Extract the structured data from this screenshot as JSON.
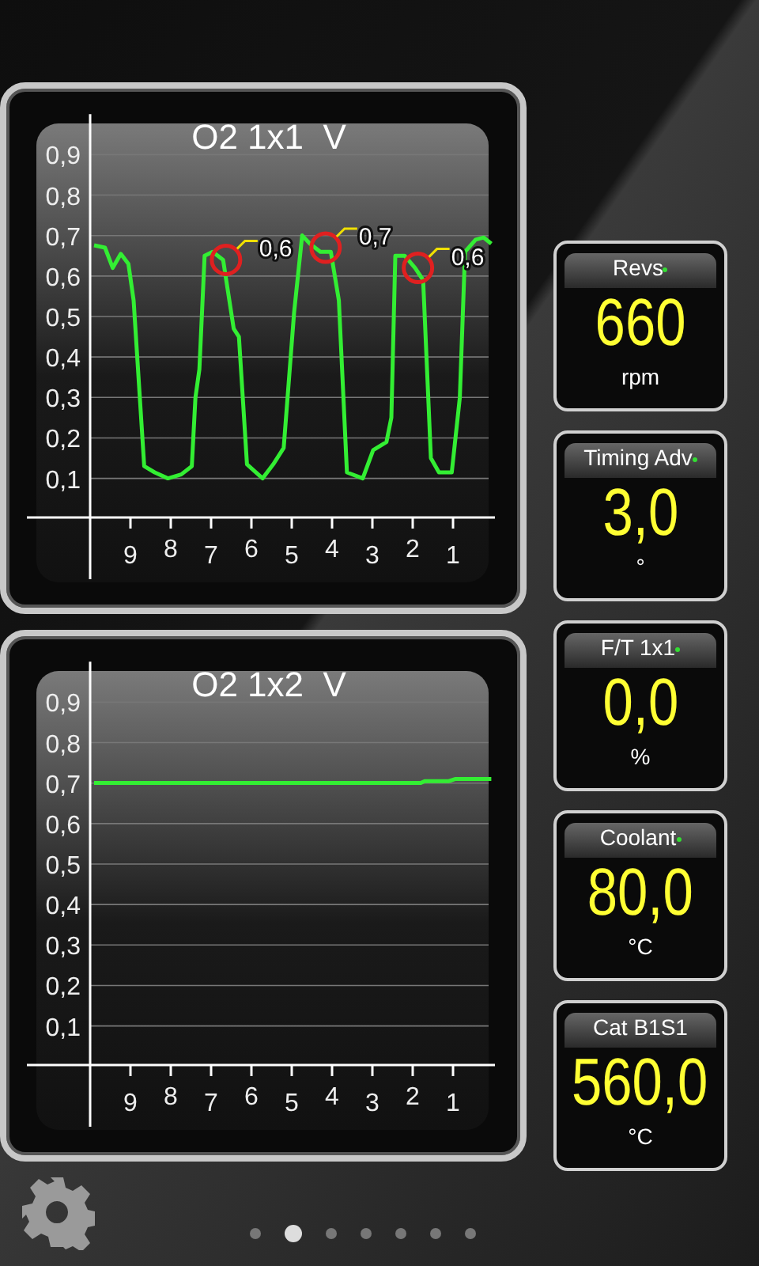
{
  "charts": [
    {
      "chart_data": {
        "type": "line",
        "title": "O2 1x1  V",
        "x": [
          9.9,
          9.63,
          9.44,
          9.24,
          9.05,
          8.92,
          8.66,
          8.4,
          8.07,
          7.74,
          7.48,
          7.39,
          7.29,
          7.16,
          6.96,
          6.7,
          6.44,
          6.31,
          6.11,
          5.72,
          5.46,
          5.2,
          4.94,
          4.74,
          4.55,
          4.29,
          4.03,
          3.83,
          3.63,
          3.24,
          2.98,
          2.65,
          2.53,
          2.43,
          2.2,
          1.94,
          1.74,
          1.55,
          1.35,
          1.03,
          0.83,
          0.7,
          0.44,
          0.24,
          0.05
        ],
        "series": [
          {
            "color": "#33ee33",
            "values": [
              0.676,
              0.67,
              0.62,
              0.655,
              0.63,
              0.54,
              0.13,
              0.115,
              0.1,
              0.11,
              0.13,
              0.3,
              0.37,
              0.65,
              0.66,
              0.64,
              0.47,
              0.45,
              0.135,
              0.1,
              0.135,
              0.175,
              0.51,
              0.7,
              0.68,
              0.66,
              0.66,
              0.54,
              0.115,
              0.1,
              0.17,
              0.19,
              0.25,
              0.65,
              0.65,
              0.62,
              0.59,
              0.15,
              0.115,
              0.115,
              0.3,
              0.66,
              0.69,
              0.695,
              0.68
            ]
          }
        ],
        "xlim": [
          10,
          0
        ],
        "ylim": [
          0,
          1
        ],
        "xticks": [
          9,
          8,
          7,
          6,
          5,
          4,
          3,
          2,
          1
        ],
        "yticks": [
          {
            "value": 0.9,
            "label": "0,9"
          },
          {
            "value": 0.8,
            "label": "0,8"
          },
          {
            "value": 0.7,
            "label": "0,7"
          },
          {
            "value": 0.6,
            "label": "0,6"
          },
          {
            "value": 0.5,
            "label": "0,5"
          },
          {
            "value": 0.4,
            "label": "0,4"
          },
          {
            "value": 0.3,
            "label": "0,3"
          },
          {
            "value": 0.2,
            "label": "0,2"
          },
          {
            "value": 0.1,
            "label": "0,1"
          }
        ],
        "grid": true,
        "annotations": [
          {
            "x": 6.63,
            "y": 0.64,
            "text": "0,6"
          },
          {
            "x": 4.16,
            "y": 0.67,
            "text": "0,7"
          },
          {
            "x": 1.87,
            "y": 0.62,
            "text": "0,6"
          }
        ]
      }
    },
    {
      "chart_data": {
        "type": "line",
        "title": "O2 1x2  V",
        "x": [
          9.9,
          1.8,
          1.7,
          1.1,
          0.95,
          0.05
        ],
        "series": [
          {
            "color": "#33ee33",
            "values": [
              0.7,
              0.7,
              0.705,
              0.705,
              0.71,
              0.71
            ]
          }
        ],
        "xlim": [
          10,
          0
        ],
        "ylim": [
          0,
          1
        ],
        "xticks": [
          9,
          8,
          7,
          6,
          5,
          4,
          3,
          2,
          1
        ],
        "yticks": [
          {
            "value": 0.9,
            "label": "0,9"
          },
          {
            "value": 0.8,
            "label": "0,8"
          },
          {
            "value": 0.7,
            "label": "0,7"
          },
          {
            "value": 0.6,
            "label": "0,6"
          },
          {
            "value": 0.5,
            "label": "0,5"
          },
          {
            "value": 0.4,
            "label": "0,4"
          },
          {
            "value": 0.3,
            "label": "0,3"
          },
          {
            "value": 0.2,
            "label": "0,2"
          },
          {
            "value": 0.1,
            "label": "0,1"
          }
        ],
        "grid": true
      }
    }
  ],
  "gauges": [
    {
      "label": "Revs",
      "indicator": true,
      "value": "660",
      "unit": "rpm"
    },
    {
      "label": "Timing Adv",
      "indicator": true,
      "value": "3,0",
      "unit": "°"
    },
    {
      "label": "F/T 1x1",
      "indicator": true,
      "value": "0,0",
      "unit": "%"
    },
    {
      "label": "Coolant",
      "indicator": true,
      "value": "80,0",
      "unit": "°C"
    },
    {
      "label": "Cat B1S1",
      "indicator": false,
      "value": "560,0",
      "unit": "°C"
    }
  ],
  "pager": [
    {
      "selected": false
    },
    {
      "selected": true
    },
    {
      "selected": false
    },
    {
      "selected": false
    },
    {
      "selected": false
    },
    {
      "selected": false
    },
    {
      "selected": false
    }
  ]
}
